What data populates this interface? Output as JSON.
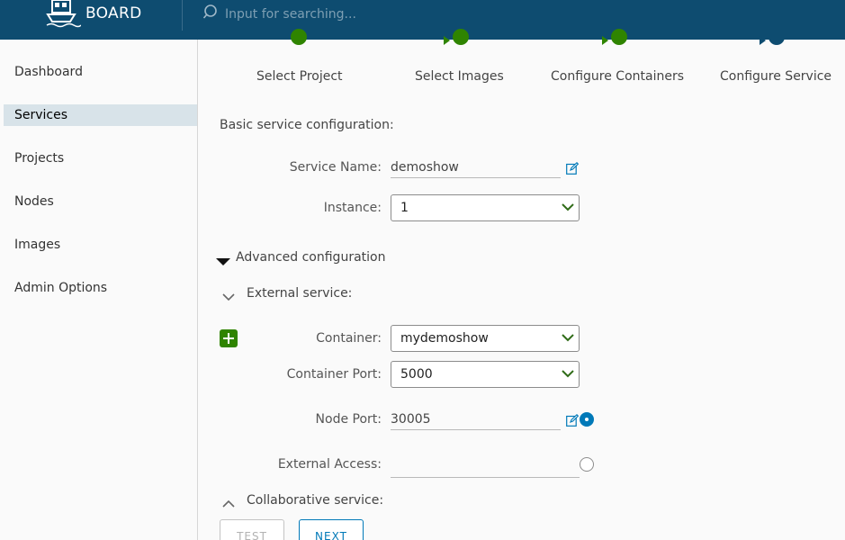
{
  "header": {
    "brand": "BOARD",
    "search_placeholder": "Input for searching...",
    "icons": {
      "logo": "ship-logo-icon",
      "search": "search-icon"
    }
  },
  "sidebar": {
    "items": [
      {
        "label": "Dashboard",
        "active": false
      },
      {
        "label": "Services",
        "active": true
      },
      {
        "label": "Projects",
        "active": false
      },
      {
        "label": "Nodes",
        "active": false
      },
      {
        "label": "Images",
        "active": false
      },
      {
        "label": "Admin Options",
        "active": false
      }
    ]
  },
  "wizard": {
    "steps": [
      {
        "label": "Select Project",
        "state": "complete"
      },
      {
        "label": "Select Images",
        "state": "complete"
      },
      {
        "label": "Configure Containers",
        "state": "complete"
      },
      {
        "label": "Configure Service",
        "state": "current"
      }
    ]
  },
  "form": {
    "basic_title": "Basic service configuration:",
    "service_name_label": "Service Name:",
    "service_name_value": "demoshow",
    "instance_label": "Instance:",
    "instance_value": "1",
    "advanced_title": "Advanced configuration",
    "external_title": "External service:",
    "container_label": "Container:",
    "container_value": "mydemoshow",
    "container_port_label": "Container Port:",
    "container_port_value": "5000",
    "node_port_label": "Node Port:",
    "node_port_value": "30005",
    "external_access_label": "External Access:",
    "external_access_value": "",
    "collaborative_title": "Collaborative service:"
  },
  "buttons": {
    "test_label": "TEST",
    "next_label": "NEXT"
  },
  "colors": {
    "header_bg": "#0e4c70",
    "step_complete": "#2f8400",
    "step_current": "#0e4c70",
    "accent_blue": "#0079b8",
    "add_green": "#2f8400",
    "active_nav_bg": "#d8e3e9"
  }
}
